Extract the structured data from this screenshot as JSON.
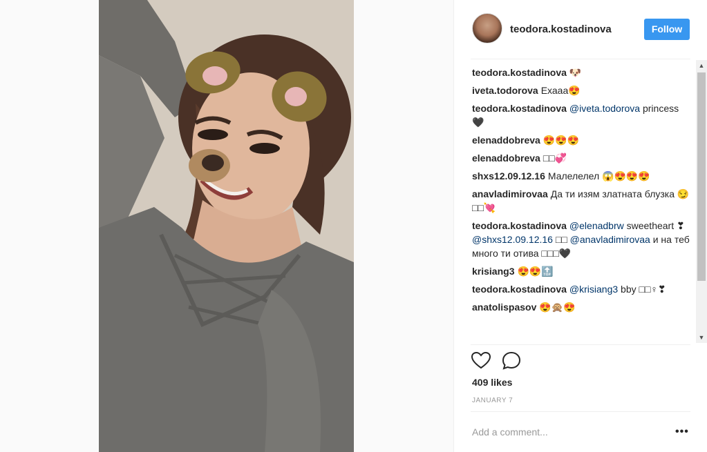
{
  "post": {
    "username": "teodora.kostadinova",
    "follow_label": "Follow"
  },
  "comments": [
    {
      "user": "teodora.kostadinova",
      "parts": [
        {
          "t": "🐶",
          "m": false
        }
      ]
    },
    {
      "user": "iveta.todorova",
      "parts": [
        {
          "t": "Ехааа😍",
          "m": false
        }
      ]
    },
    {
      "user": "teodora.kostadinova",
      "parts": [
        {
          "t": "@iveta.todorova",
          "m": true
        },
        {
          "t": " princess 🖤",
          "m": false
        }
      ]
    },
    {
      "user": "elenaddobreva",
      "parts": [
        {
          "t": "😍😍😍",
          "m": false
        }
      ]
    },
    {
      "user": "elenaddobreva",
      "parts": [
        {
          "t": "□□💞",
          "m": false
        }
      ]
    },
    {
      "user": "shxs12.09.12.16",
      "parts": [
        {
          "t": "Малелелел 😱😍😍😍",
          "m": false
        }
      ]
    },
    {
      "user": "anavladimirovaa",
      "parts": [
        {
          "t": "Да ти изям златната блузка 😏□□💘",
          "m": false
        }
      ]
    },
    {
      "user": "teodora.kostadinova",
      "parts": [
        {
          "t": "@elenadbrw",
          "m": true
        },
        {
          "t": " sweetheart ❣ ",
          "m": false
        },
        {
          "t": "@shxs12.09.12.16",
          "m": true
        },
        {
          "t": " □□ ",
          "m": false
        },
        {
          "t": "@anavladimirovaa",
          "m": true
        },
        {
          "t": " и на теб много ти отива □□□🖤",
          "m": false
        }
      ]
    },
    {
      "user": "krisiang3",
      "parts": [
        {
          "t": "😍😍🔝",
          "m": false
        }
      ]
    },
    {
      "user": "teodora.kostadinova",
      "parts": [
        {
          "t": "@krisiang3",
          "m": true
        },
        {
          "t": " bby □□♀❣",
          "m": false
        }
      ]
    },
    {
      "user": "anatolispasov",
      "parts": [
        {
          "t": "😍🙊😍",
          "m": false
        }
      ]
    }
  ],
  "likes": "409 likes",
  "date": "JANUARY 7",
  "add_comment_placeholder": "Add a comment...",
  "more_label": "•••",
  "scroll_up": "▲",
  "scroll_down": "▼",
  "icons": {
    "like": "heart-icon",
    "comment": "comment-bubble-icon"
  },
  "colors": {
    "follow_button": "#3897f0",
    "mention": "#003569"
  }
}
